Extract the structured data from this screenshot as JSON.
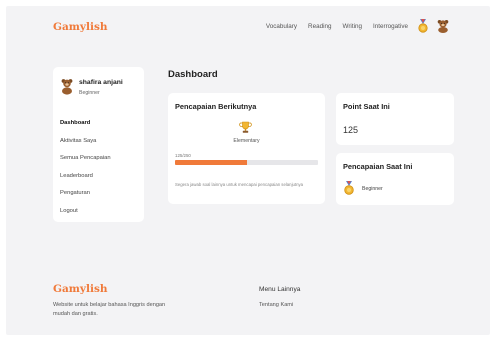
{
  "navbar": {
    "brand": "Gamylish",
    "links": [
      "Vocabulary",
      "Reading",
      "Writing",
      "Interrogative"
    ],
    "icons": [
      "medal-icon",
      "bear-avatar-icon"
    ]
  },
  "user": {
    "name": "shafira anjani",
    "level": "Beginner",
    "avatar_icon": "bear-avatar-icon"
  },
  "sidebar": {
    "items": [
      "Dashboard",
      "Aktivitas Saya",
      "Semua Pencapaian",
      "Leaderboard",
      "Pengaturan",
      "Logout"
    ],
    "active": "Dashboard"
  },
  "dashboard": {
    "title": "Dashboard",
    "next_achievement": {
      "title": "Pencapaian Berikutnya",
      "name": "Elementary",
      "icon": "trophy-icon",
      "progress_text": "125/250",
      "progress": 0.5,
      "hint": "Segera jawab soal lainnya untuk mencapai pencapaian selanjutnya"
    },
    "points": {
      "title": "Point Saat Ini",
      "value": "125"
    },
    "current_achievement": {
      "title": "Pencapaian Saat Ini",
      "level": "Beginner",
      "icon": "medal-icon"
    }
  },
  "footer": {
    "brand": "Gamylish",
    "description": "Website untuk belajar bahasa Inggris dengan mudah dan gratis.",
    "menu_title": "Menu Lainnya",
    "links": [
      "Tentang Kami"
    ]
  },
  "colors": {
    "brand": "#f07a3a",
    "background": "#f3f3f5",
    "card": "#ffffff",
    "progress_track": "#e6e6e9"
  }
}
